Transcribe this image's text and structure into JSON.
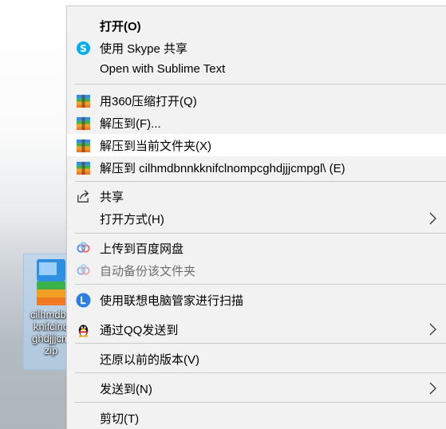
{
  "desktop_icon": {
    "caption": "cilhmdbnnkknifclnomp cghdjjjcmpgl.zip",
    "caption_lines": [
      "cilhmdbn",
      "knifclno",
      "ghdjjjcm",
      "zip"
    ]
  },
  "menu": {
    "open": "打开(O)",
    "skype": "使用 Skype 共享",
    "sublime": "Open with Sublime Text",
    "open_360": "用360压缩打开(Q)",
    "extract_to": "解压到(F)...",
    "extract_here": "解压到当前文件夹(X)",
    "extract_folder": "解压到 cilhmdbnnkknifclnompcghdjjjcmpgl\\ (E)",
    "share": "共享",
    "open_with": "打开方式(H)",
    "upload_baidu": "上传到百度网盘",
    "auto_backup": "自动备份该文件夹",
    "lenovo_scan": "使用联想电脑管家进行扫描",
    "send_qq": "通过QQ发送到",
    "restore_prev": "还原以前的版本(V)",
    "send_to": "发送到(N)",
    "cut": "剪切(T)"
  },
  "colors": {
    "menu_bg": "#f2f2f2",
    "hover_bg": "#ffffff",
    "skype_blue": "#00aff0",
    "lenovo_blue": "#2b7fe0",
    "disabled_text": "#6d6d6d"
  }
}
